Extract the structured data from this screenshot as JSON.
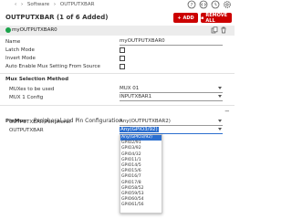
{
  "breadcrumb": {
    "items": [
      "Software",
      "OUTPUTXBAR"
    ]
  },
  "header": {
    "title": "OUTPUTXBAR (1 of 6 Added)",
    "add_label": "ADD",
    "remove_label": "REMOVE ALL"
  },
  "instance": {
    "name": "myOUTPUTXBAR0"
  },
  "fields": {
    "name_label": "Name",
    "name_value": "myOUTPUTXBAR0",
    "latch_label": "Latch Mode",
    "invert_label": "Invert Mode",
    "auto_label": "Auto Enable Mux Setting From Source"
  },
  "mux": {
    "section_title": "Mux Selection Method",
    "used_label": "MUXes to be used",
    "used_value": "MUX 01",
    "config_label": "MUX 1 Config",
    "config_value": "INPUTXBAR1"
  },
  "pinmux": {
    "section_title": "PinMux",
    "section_subtitle": "Peripheral and Pin Configuration",
    "peripheral_label": "OUTPUTXBAR Peripheral",
    "peripheral_value": "Any(OUTPUTXBAR2)",
    "pin_label": "OUTPUTXBAR",
    "pin_value": "Any(GPIO3/92)",
    "options": [
      "Any(GPIO3/92)",
      "GPIO2/91",
      "GPIO3/92",
      "GPIO4/32",
      "GPIO11/1",
      "GPIO14/5",
      "GPIO15/6",
      "GPIO16/7",
      "GPIO17/8",
      "GPIO58/52",
      "GPIO59/53",
      "GPIO60/54",
      "GPIO61/56"
    ]
  },
  "colors": {
    "accent": "#cc0000",
    "selected": "#2c6fcf",
    "ok": "#1aa34a"
  },
  "icons": [
    "chevron-left-icon",
    "chevron-right-icon",
    "help-icon",
    "code-icon",
    "history-icon",
    "settings-icon",
    "copy-icon",
    "delete-icon"
  ]
}
